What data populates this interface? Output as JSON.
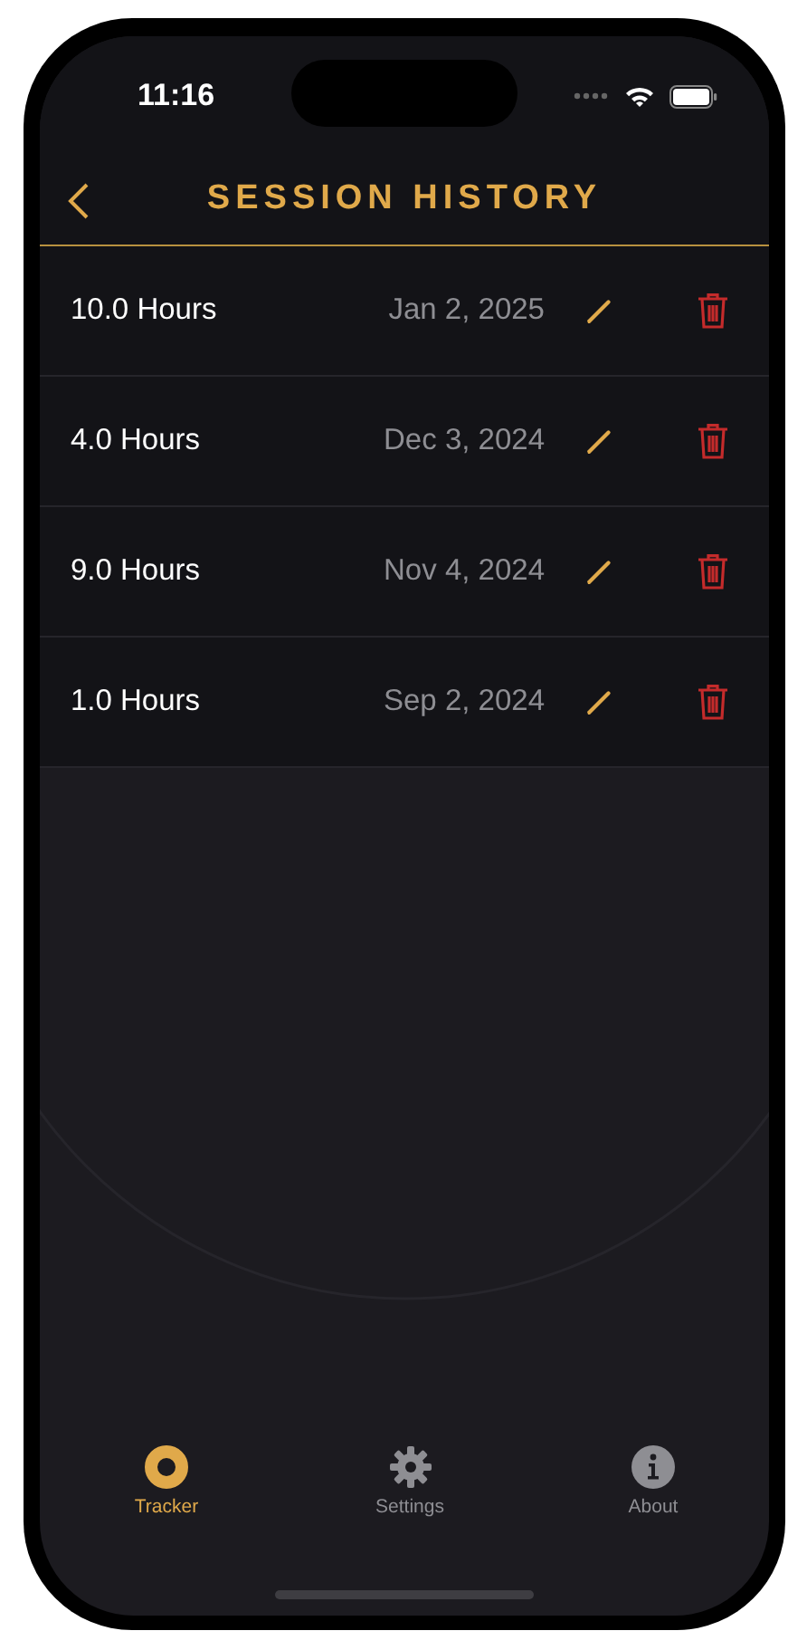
{
  "status_bar": {
    "time": "11:16"
  },
  "header": {
    "title": "SESSION HISTORY"
  },
  "sessions": [
    {
      "hours": "10.0 Hours",
      "date": "Jan 2, 2025"
    },
    {
      "hours": "4.0 Hours",
      "date": "Dec 3, 2024"
    },
    {
      "hours": "9.0 Hours",
      "date": "Nov 4, 2024"
    },
    {
      "hours": "1.0 Hours",
      "date": "Sep 2, 2024"
    }
  ],
  "tabs": [
    {
      "kind": "tracker",
      "label": "Tracker",
      "selected": true
    },
    {
      "kind": "settings",
      "label": "Settings",
      "selected": false
    },
    {
      "kind": "about",
      "label": "About",
      "selected": false
    }
  ]
}
